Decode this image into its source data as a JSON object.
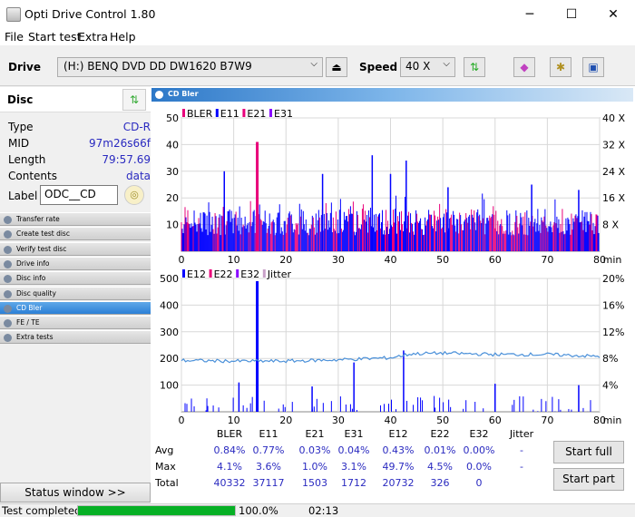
{
  "app": {
    "title": "Opti Drive Control 1.80",
    "minimize": "─",
    "maximize": "☐",
    "close": "✕"
  },
  "menu": [
    "File",
    "Start test",
    "Extra",
    "Help"
  ],
  "toolbar": {
    "drive_label": "Drive",
    "drive_value": "(H:)   BENQ DVD DD DW1620 B7W9",
    "speed_label": "Speed",
    "speed_value": "40 X"
  },
  "disc": {
    "title": "Disc",
    "fields": [
      {
        "k": "Type",
        "v": "CD-R"
      },
      {
        "k": "MID",
        "v": "97m26s66f"
      },
      {
        "k": "Length",
        "v": "79:57.69"
      },
      {
        "k": "Contents",
        "v": "data"
      }
    ],
    "label_key": "Label",
    "label_value": "ODC__CD"
  },
  "nav": [
    {
      "label": "Transfer rate",
      "active": false
    },
    {
      "label": "Create test disc",
      "active": false
    },
    {
      "label": "Verify test disc",
      "active": false
    },
    {
      "label": "Drive info",
      "active": false
    },
    {
      "label": "Disc info",
      "active": false
    },
    {
      "label": "Disc quality",
      "active": false
    },
    {
      "label": "CD Bler",
      "active": true
    },
    {
      "label": "FE / TE",
      "active": false
    },
    {
      "label": "Extra tests",
      "active": false
    }
  ],
  "status_window_label": "Status window >>",
  "status": {
    "text": "Test completed",
    "progress": 1.0,
    "percent": "100.0%",
    "elapsed": "02:13"
  },
  "panel_title": "CD Bler",
  "chart_data": [
    {
      "type": "bar",
      "legend": [
        "BLER",
        "E11",
        "E21",
        "E31"
      ],
      "legend_colors": [
        "#e8007a",
        "#0000ff",
        "#e8007a",
        "#8800ff"
      ],
      "xlim": [
        0,
        80
      ],
      "xticks": [
        0,
        10,
        20,
        30,
        40,
        50,
        60,
        70,
        80
      ],
      "xunit": "min",
      "ylim": [
        0,
        50
      ],
      "yticks": [
        10,
        20,
        30,
        40,
        50
      ],
      "y2ticks": [
        "8 X",
        "16 X",
        "24 X",
        "32 X",
        "40 X"
      ],
      "peaks": [
        {
          "x": 14.5,
          "y": 41
        },
        {
          "x": 8.2,
          "y": 30
        },
        {
          "x": 36.5,
          "y": 36
        },
        {
          "x": 43,
          "y": 34
        },
        {
          "x": 40,
          "y": 29
        },
        {
          "x": 27,
          "y": 29
        },
        {
          "x": 51,
          "y": 24
        },
        {
          "x": 67,
          "y": 25
        },
        {
          "x": 76,
          "y": 23
        }
      ]
    },
    {
      "type": "bar",
      "legend": [
        "E12",
        "E22",
        "E32",
        "Jitter"
      ],
      "legend_colors": [
        "#0000ff",
        "#e8007a",
        "#8800ff",
        "#c8a0c8"
      ],
      "xlim": [
        0,
        80
      ],
      "xticks": [
        0,
        10,
        20,
        30,
        40,
        50,
        60,
        70,
        80
      ],
      "xunit": "min",
      "ylim": [
        0,
        500
      ],
      "yticks": [
        100,
        200,
        300,
        400,
        500
      ],
      "y2ticks": [
        "4%",
        "8%",
        "12%",
        "16%",
        "20%"
      ],
      "peaks": [
        {
          "x": 14.5,
          "y": 490
        },
        {
          "x": 42.5,
          "y": 230
        },
        {
          "x": 33,
          "y": 185
        },
        {
          "x": 11,
          "y": 110
        },
        {
          "x": 25,
          "y": 95
        },
        {
          "x": 60,
          "y": 105
        },
        {
          "x": 76,
          "y": 100
        }
      ],
      "jitter_pct": [
        {
          "x": 0,
          "y": 7.7
        },
        {
          "x": 10,
          "y": 7.6
        },
        {
          "x": 20,
          "y": 7.6
        },
        {
          "x": 30,
          "y": 7.8
        },
        {
          "x": 40,
          "y": 8.1
        },
        {
          "x": 44,
          "y": 8.7
        },
        {
          "x": 50,
          "y": 8.8
        },
        {
          "x": 60,
          "y": 8.6
        },
        {
          "x": 70,
          "y": 8.6
        },
        {
          "x": 80,
          "y": 8.3
        }
      ]
    }
  ],
  "table": {
    "columns": [
      "BLER",
      "E11",
      "E21",
      "E31",
      "E12",
      "E22",
      "E32",
      "Jitter"
    ],
    "rows": [
      {
        "name": "Avg",
        "values": [
          "0.84%",
          "0.77%",
          "0.03%",
          "0.04%",
          "0.43%",
          "0.01%",
          "0.00%",
          "-"
        ]
      },
      {
        "name": "Max",
        "values": [
          "4.1%",
          "3.6%",
          "1.0%",
          "3.1%",
          "49.7%",
          "4.5%",
          "0.0%",
          "-"
        ]
      },
      {
        "name": "Total",
        "values": [
          "40332",
          "37117",
          "1503",
          "1712",
          "20732",
          "326",
          "0",
          ""
        ]
      }
    ]
  },
  "buttons": {
    "start_full": "Start full",
    "start_part": "Start part"
  }
}
